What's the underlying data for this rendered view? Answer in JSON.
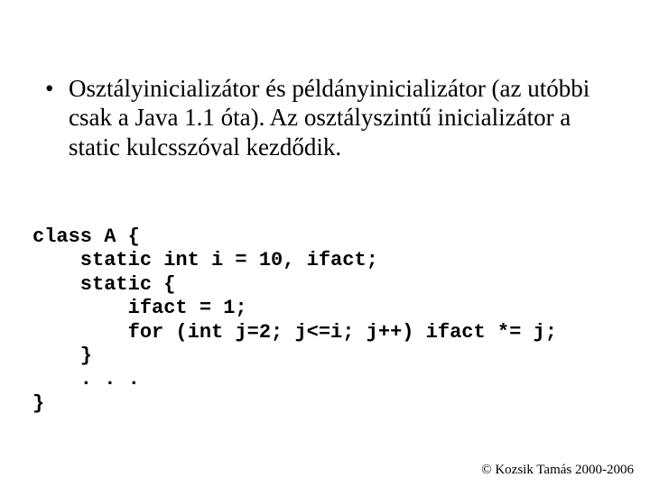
{
  "bullet": {
    "text": "Osztályinicializátor és példányinicializátor (az utóbbi csak a Java 1.1 óta). Az osztályszintű inicializátor a static kulcsszóval kezdődik."
  },
  "code": {
    "line1": "class A {",
    "line2": "    static int i = 10, ifact;",
    "line3": "    static {",
    "line4": "        ifact = 1;",
    "line5": "        for (int j=2; j<=i; j++) ifact *= j;",
    "line6": "    }",
    "line7": "    . . .",
    "line8": "}"
  },
  "footer": {
    "text": "© Kozsik Tamás 2000-2006"
  }
}
